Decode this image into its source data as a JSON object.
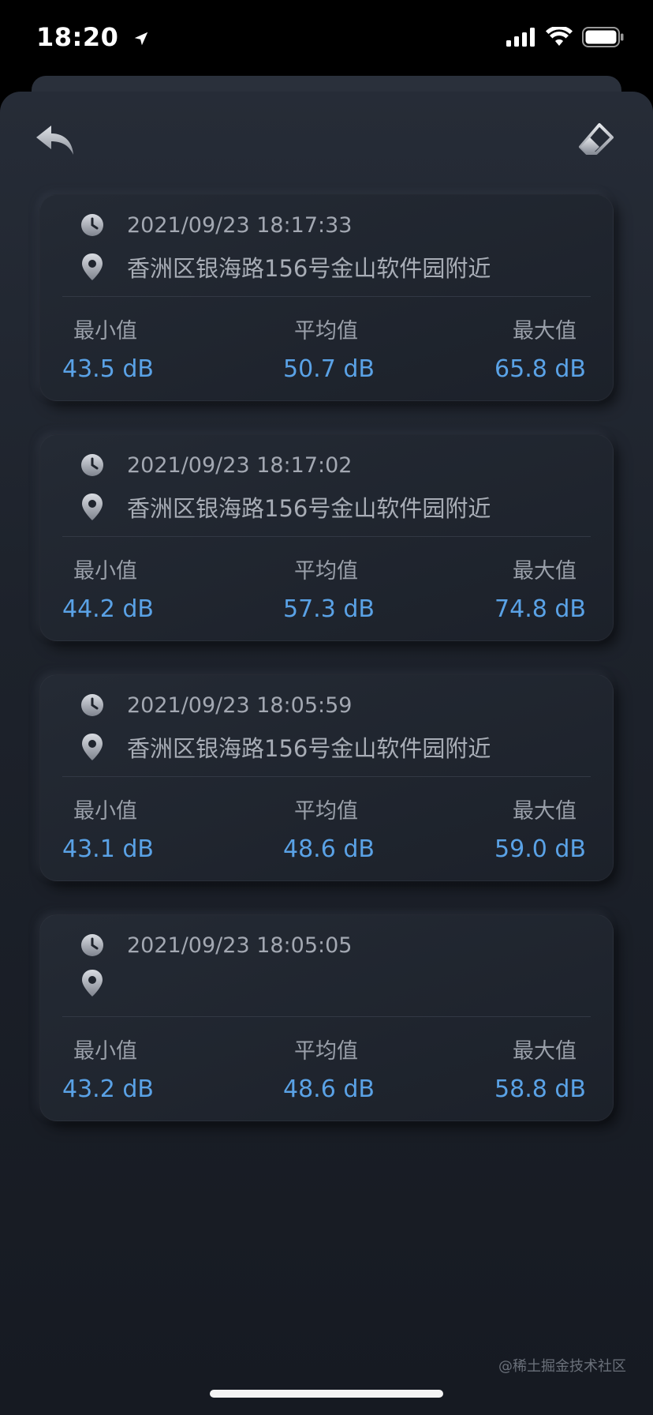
{
  "status_bar": {
    "time": "18:20",
    "icons": [
      "location-arrow-icon",
      "cellular-signal-icon",
      "wifi-icon",
      "battery-icon"
    ]
  },
  "toolbar": {
    "back_icon": "back-arrow-icon",
    "clear_icon": "eraser-icon"
  },
  "labels": {
    "min": "最小值",
    "avg": "平均值",
    "max": "最大值"
  },
  "records": [
    {
      "datetime": "2021/09/23 18:17:33",
      "address": "香洲区银海路156号金山软件园附近",
      "min": "43.5 dB",
      "avg": "50.7 dB",
      "max": "65.8 dB"
    },
    {
      "datetime": "2021/09/23 18:17:02",
      "address": "香洲区银海路156号金山软件园附近",
      "min": "44.2 dB",
      "avg": "57.3 dB",
      "max": "74.8 dB"
    },
    {
      "datetime": "2021/09/23 18:05:59",
      "address": "香洲区银海路156号金山软件园附近",
      "min": "43.1 dB",
      "avg": "48.6 dB",
      "max": "59.0 dB"
    },
    {
      "datetime": "2021/09/23 18:05:05",
      "address": "",
      "min": "43.2 dB",
      "avg": "48.6 dB",
      "max": "58.8 dB"
    }
  ],
  "watermark": "@稀土掘金技术社区",
  "colors": {
    "value_blue": "#5aa2e6",
    "label_gray": "#9aa0aa",
    "card_bg": "#1f242d"
  }
}
